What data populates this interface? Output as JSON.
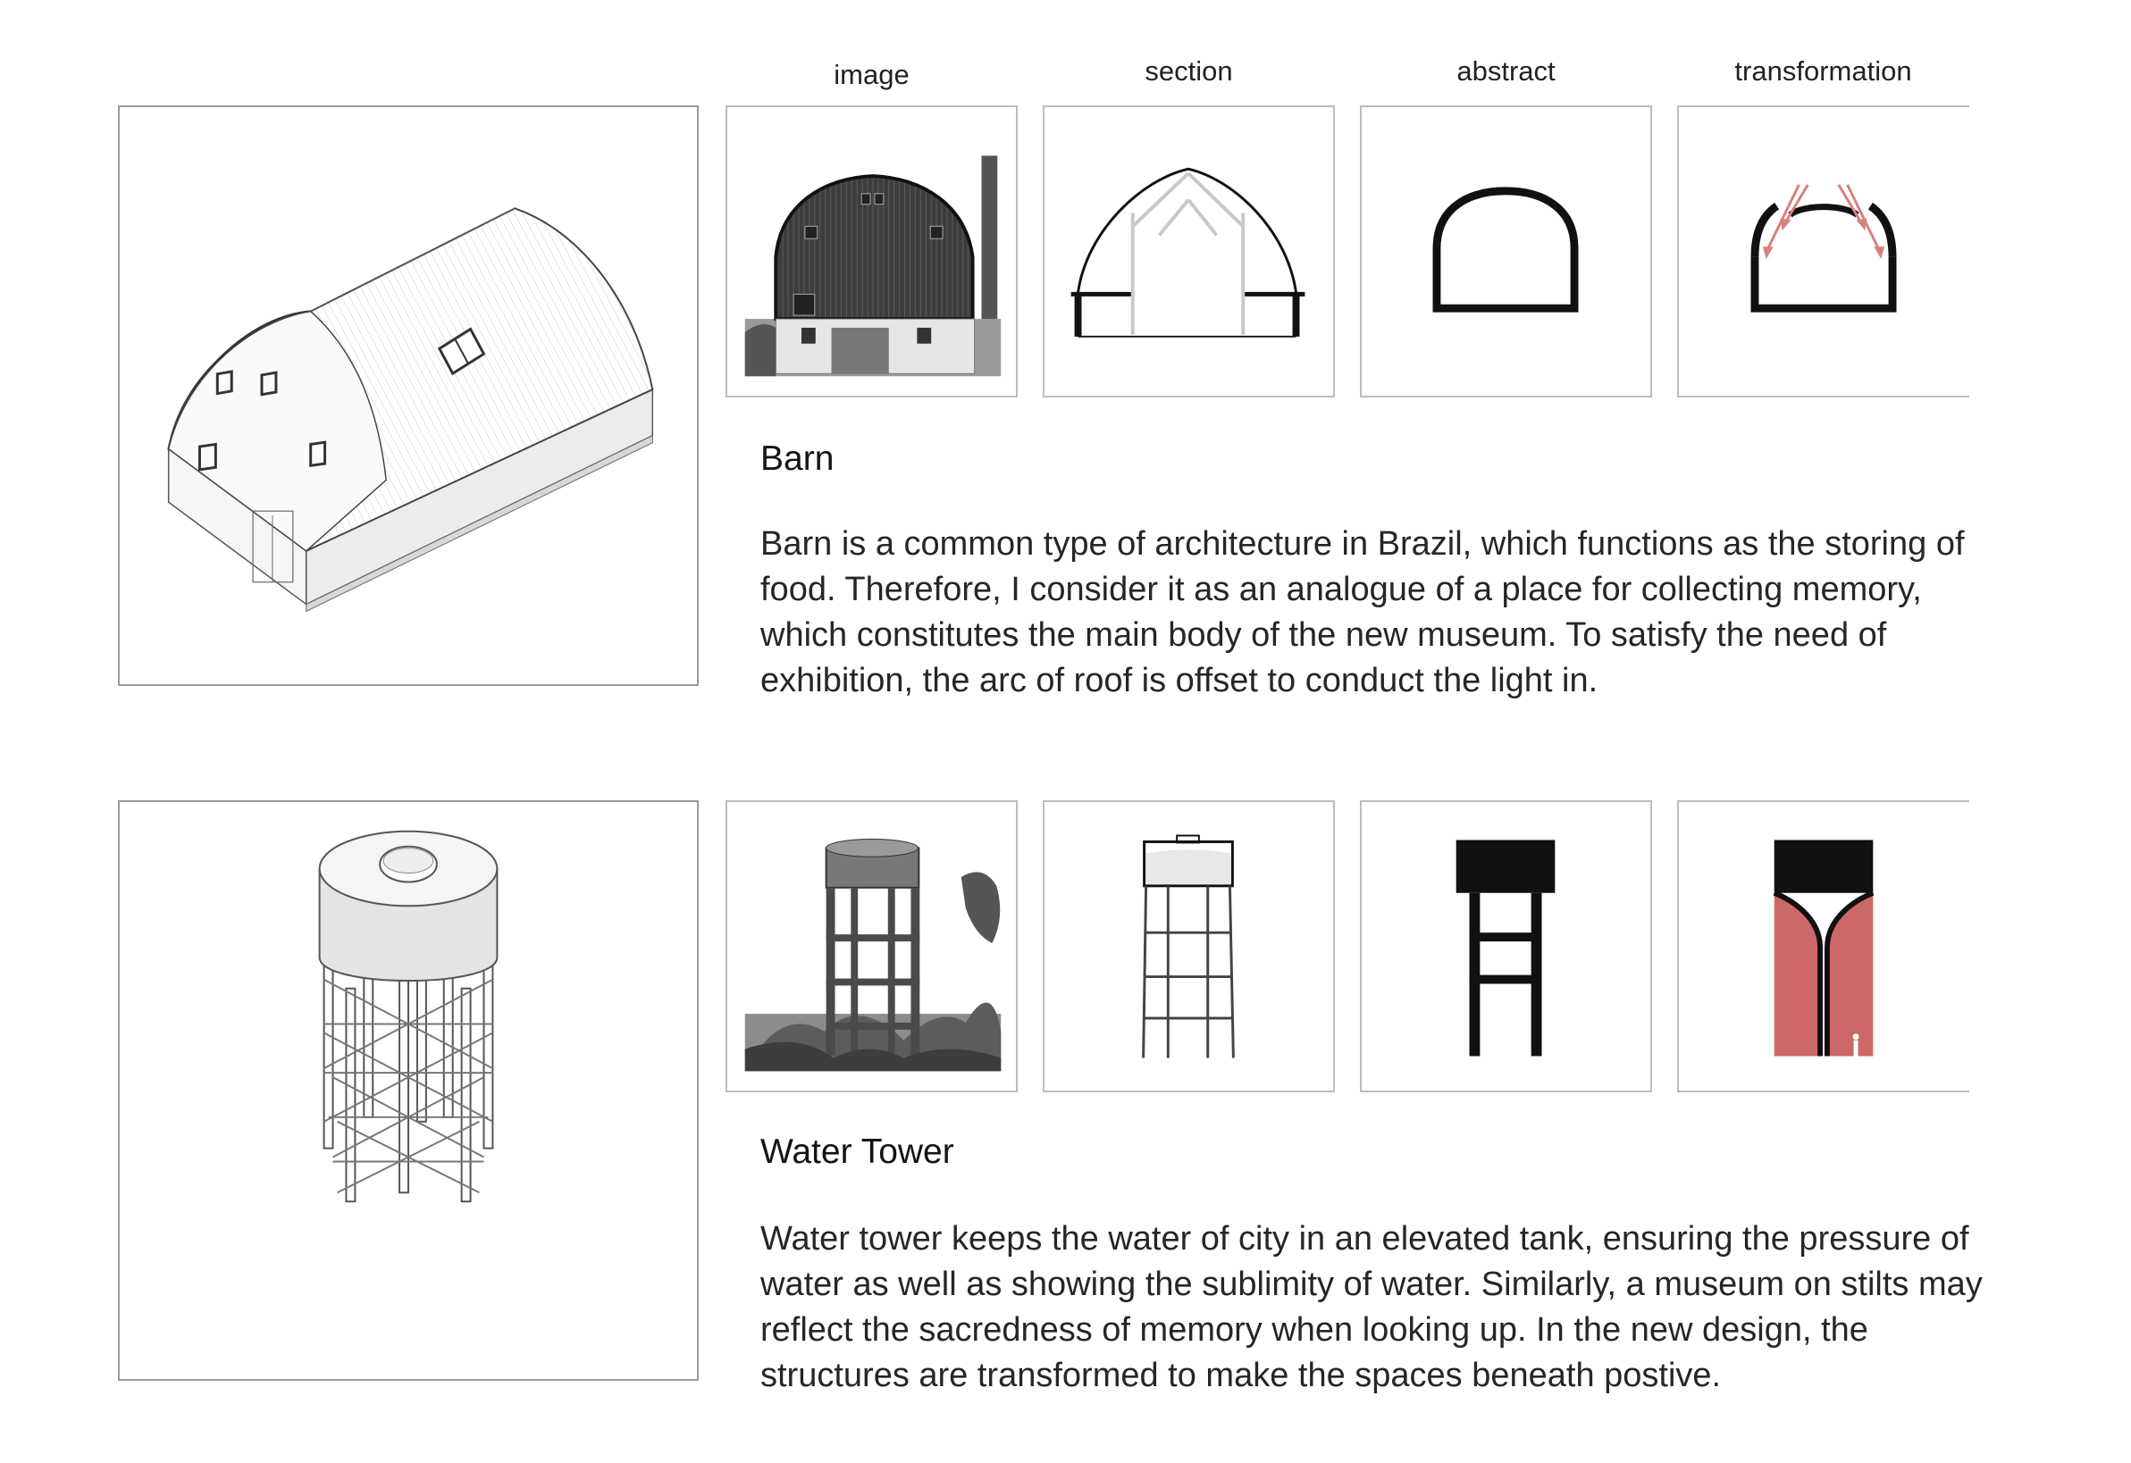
{
  "columns": [
    "image",
    "section",
    "abstract",
    "transformation"
  ],
  "rows": [
    {
      "title": "Barn",
      "description": "Barn is a common type of architecture in Brazil, which functions as the storing of food. Therefore, I consider it as an analogue of a place for collecting memory, which constitutes the main body of the new museum. To satisfy the need of exhibition, the arc of roof is offset to conduct the light in."
    },
    {
      "title": "Water Tower",
      "description": "Water tower keeps the water of city in an elevated tank, ensuring the pressure of water as well as showing the sublimity of water. Similarly, a museum on stilts may reflect the sacredness of memory when looking up. In the new design, the structures are transformed to make the spaces beneath postive."
    }
  ],
  "colors": {
    "accent_red": "#cd6868",
    "arrow_red": "#d9807c",
    "ink": "#111111"
  }
}
